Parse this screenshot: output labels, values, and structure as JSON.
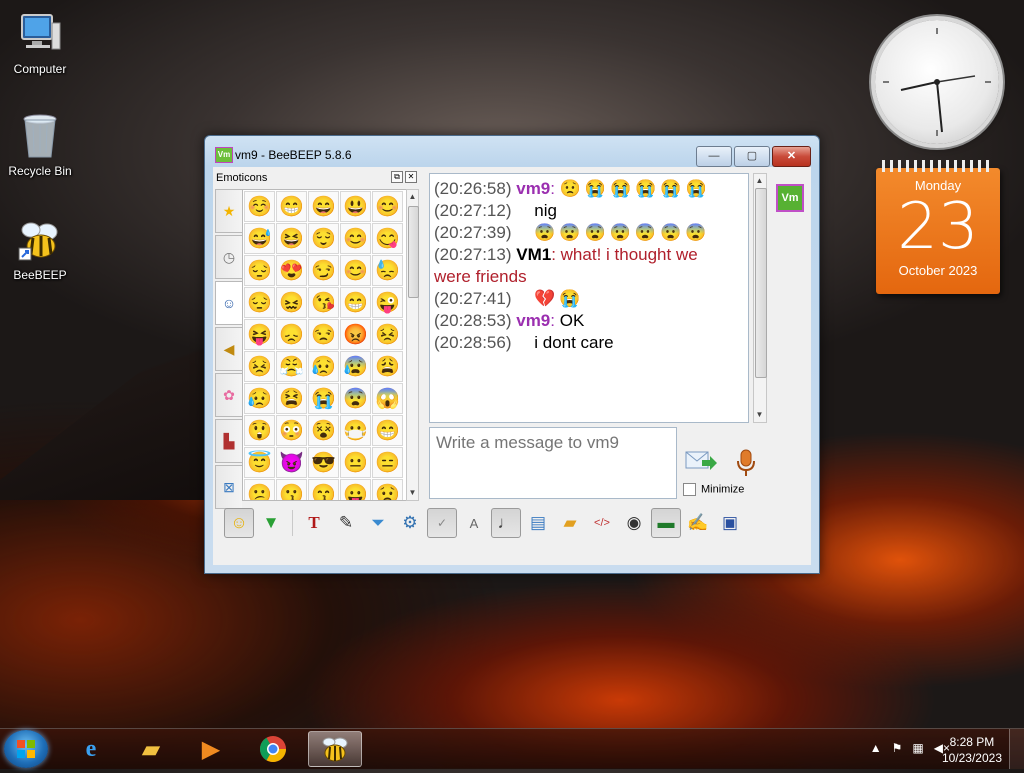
{
  "desktop": {
    "icons": [
      {
        "label": "Computer"
      },
      {
        "label": "Recycle Bin"
      },
      {
        "label": "BeeBEEP"
      }
    ]
  },
  "calendar": {
    "day": "Monday",
    "date": "23",
    "month": "October 2023"
  },
  "window": {
    "icon_text": "Vm",
    "title": "vm9 - BeeBEEP 5.8.6",
    "controls": {
      "minimize": "—",
      "maximize": "▢",
      "close": "✕"
    }
  },
  "emoticons": {
    "title": "Emoticons",
    "tabs": [
      "star-icon",
      "clock-icon",
      "people-icon",
      "bell-icon",
      "flower-icon",
      "building-icon",
      "symbol-icon"
    ],
    "grid": [
      "☺️",
      "😁",
      "😄",
      "😃",
      "😊",
      "😅",
      "😆",
      "😌",
      "😊",
      "😋",
      "😔",
      "😍",
      "😏",
      "😊",
      "😓",
      "😔",
      "😖",
      "😘",
      "😁",
      "😜",
      "😝",
      "😞",
      "😒",
      "😡",
      "😣",
      "😣",
      "😤",
      "😥",
      "😰",
      "😩",
      "😥",
      "😫",
      "😭",
      "😨",
      "😱",
      "😲",
      "😳",
      "😵",
      "😷",
      "😁",
      "😇",
      "😈",
      "😎",
      "😐",
      "😑",
      "😕",
      "😗",
      "😙",
      "😛",
      "😟",
      "😦",
      "😧",
      "😬",
      "😮",
      "😯"
    ]
  },
  "chat": {
    "messages": [
      {
        "time": "(20:26:58)",
        "nick": "vm9",
        "sep": ": ",
        "text": "",
        "emoji": "😟😭😭😭😭😭"
      },
      {
        "time": "(20:27:12)",
        "nick": "",
        "sep": "",
        "text": "nig",
        "emoji": ""
      },
      {
        "time": "(20:27:39)",
        "nick": "",
        "sep": "",
        "text": "",
        "emoji": "😨😨😨😨😨😨😨"
      },
      {
        "time": "(20:27:13)",
        "nick": "VM1",
        "sep": ": ",
        "text": "what! i thought we were friends",
        "emoji": ""
      },
      {
        "time": "(20:27:41)",
        "nick": "",
        "sep": "",
        "text": "",
        "emoji": "💔😭"
      },
      {
        "time": "(20:28:53)",
        "nick": "vm9",
        "sep": ": ",
        "text": "OK",
        "emoji": ""
      },
      {
        "time": "(20:28:56)",
        "nick": "",
        "sep": "",
        "text": "i dont care",
        "emoji": ""
      }
    ]
  },
  "compose": {
    "placeholder": "Write a message to vm9",
    "minimize_label": "Minimize"
  },
  "sidebar": {
    "user_avatar": "Vm"
  },
  "toolbar": {
    "buttons": [
      "emoticons-icon",
      "send-file-icon",
      "font-icon",
      "color-icon",
      "filter-icon",
      "settings-icon",
      "spellcheck-icon",
      "completer-icon",
      "music-icon",
      "save-chat-icon",
      "folder-icon",
      "html-icon",
      "screenshot-icon",
      "terminal-icon",
      "edit-icon",
      "save-icon"
    ]
  },
  "taskbar": {
    "time": "8:28 PM",
    "date": "10/23/2023",
    "apps": [
      "start-button",
      "internet-explorer-icon",
      "file-explorer-icon",
      "media-player-icon",
      "chrome-icon",
      "beebeep-icon"
    ]
  },
  "colors": {
    "accent": "#9b2fb0",
    "vm1_text": "#b0202c",
    "calendar": "#e4670f"
  }
}
